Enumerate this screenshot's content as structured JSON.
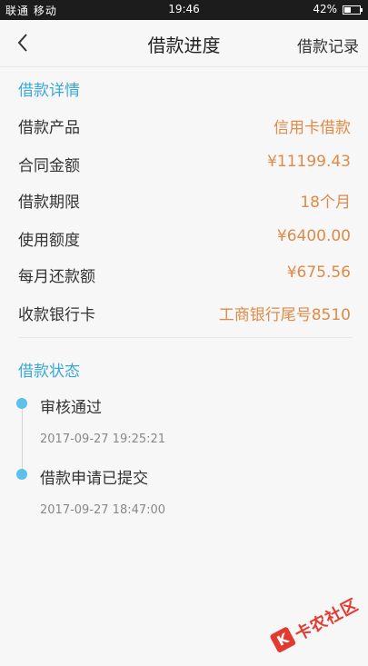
{
  "status_bar": {
    "signal": "联通 移动",
    "time": "19:46",
    "battery": "42%"
  },
  "nav": {
    "title": "借款进度",
    "right": "借款记录"
  },
  "details": {
    "header": "借款详情",
    "rows": [
      {
        "label": "借款产品",
        "value": "信用卡借款"
      },
      {
        "label": "合同金额",
        "value": "¥11199.43"
      },
      {
        "label": "借款期限",
        "value": "18个月"
      },
      {
        "label": "使用额度",
        "value": "¥6400.00"
      },
      {
        "label": "每月还款额",
        "value": "¥675.56"
      },
      {
        "label": "收款银行卡",
        "value": "工商银行尾号8510"
      }
    ]
  },
  "status": {
    "header": "借款状态",
    "events": [
      {
        "title": "审核通过",
        "time": "2017-09-27 19:25:21"
      },
      {
        "title": "借款申请已提交",
        "time": "2017-09-27 18:47:00"
      }
    ]
  },
  "watermark": {
    "logo": "K",
    "text": "卡农社区"
  },
  "colors": {
    "accent": "#3aa9d9",
    "value": "#e08a47",
    "dot": "#5cc0ea",
    "watermark": "#e33a2f"
  }
}
